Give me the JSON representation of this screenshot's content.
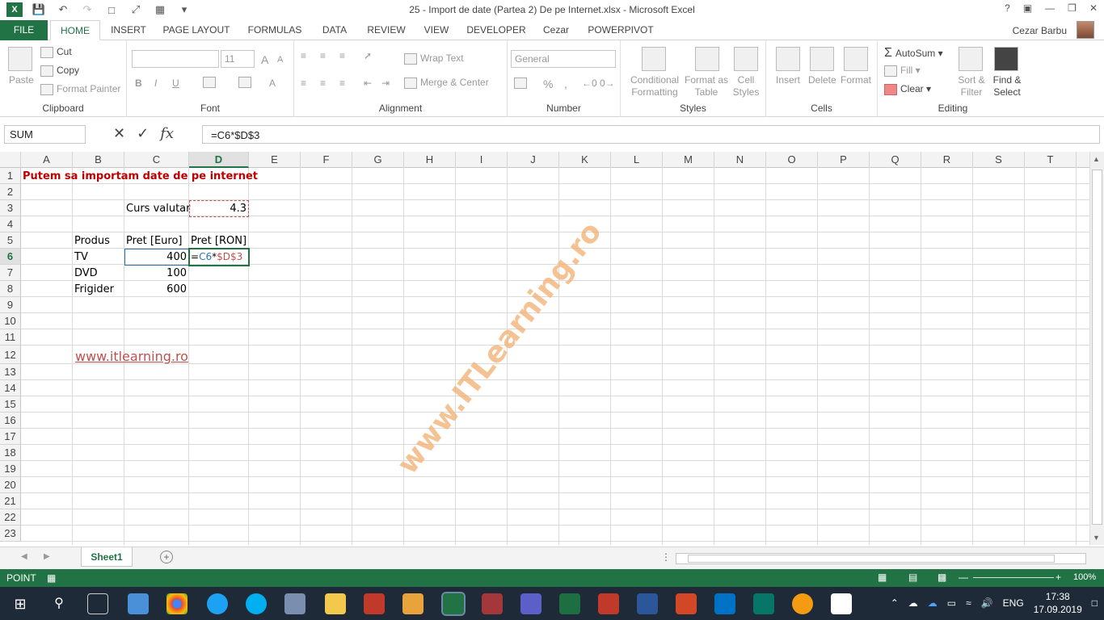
{
  "window": {
    "title": "25 - Import de date (Partea 2) De pe Internet.xlsx - Microsoft Excel",
    "help": "?",
    "user": "Cezar Barbu"
  },
  "tabs": [
    "FILE",
    "HOME",
    "INSERT",
    "PAGE LAYOUT",
    "FORMULAS",
    "DATA",
    "REVIEW",
    "VIEW",
    "DEVELOPER",
    "Cezar",
    "POWERPIVOT"
  ],
  "active_tab": "HOME",
  "ribbon": {
    "clipboard": {
      "label": "Clipboard",
      "paste": "Paste",
      "cut": "Cut",
      "copy": "Copy",
      "format_painter": "Format Painter"
    },
    "font": {
      "label": "Font",
      "size": "11",
      "bold": "B",
      "italic": "I",
      "underline": "U",
      "grow": "A",
      "shrink": "A",
      "color": "A"
    },
    "alignment": {
      "label": "Alignment",
      "wrap": "Wrap Text",
      "merge": "Merge & Center"
    },
    "number": {
      "label": "Number",
      "format": "General",
      "percent": "%",
      "comma": ","
    },
    "styles": {
      "label": "Styles",
      "conditional": "Conditional Formatting",
      "format_table": "Format as Table",
      "cell_styles": "Cell Styles"
    },
    "cells": {
      "label": "Cells",
      "insert": "Insert",
      "delete": "Delete",
      "format": "Format"
    },
    "editing": {
      "label": "Editing",
      "autosum": "AutoSum",
      "fill": "Fill",
      "clear": "Clear",
      "sort": "Sort & Filter",
      "find": "Find & Select"
    }
  },
  "formula_bar": {
    "name_box": "SUM",
    "fx": "fx",
    "formula": "=C6*$D$3"
  },
  "columns": [
    "A",
    "B",
    "C",
    "D",
    "E",
    "F",
    "G",
    "H",
    "I",
    "J",
    "K",
    "L",
    "M",
    "N",
    "O",
    "P",
    "Q",
    "R",
    "S",
    "T"
  ],
  "rows": [
    "1",
    "2",
    "3",
    "4",
    "5",
    "6",
    "7",
    "8",
    "9",
    "10",
    "11",
    "12",
    "13",
    "14",
    "15",
    "16",
    "17",
    "18",
    "19",
    "20",
    "21",
    "22",
    "23"
  ],
  "selected_col": "D",
  "selected_row": "6",
  "cells": {
    "A1": "Putem sa importam date de pe internet",
    "C3": "Curs valutar",
    "D3": "4.3",
    "B5": "Produs",
    "C5": "Pret [Euro]",
    "D5": "Pret [RON]",
    "B6": "TV",
    "C6": "400",
    "D6_eq": "=",
    "D6_ref1": "C6",
    "D6_op": "*",
    "D6_ref2": "$D$3",
    "B7": "DVD",
    "C7": "100",
    "B8": "Frigider",
    "C8": "600",
    "B12": "www.itlearning.ro"
  },
  "watermark": "www.ITLearning.ro",
  "sheet_tab": "Sheet1",
  "status": {
    "mode": "POINT",
    "zoom": "100%"
  },
  "taskbar": {
    "lang": "ENG",
    "time": "17:38",
    "date": "17.09.2019"
  },
  "colors": {
    "excel_green": "#217346",
    "title_red": "#c00000",
    "ref1": "#2f75b5",
    "ref2": "#c0504d",
    "link": "#c0504d"
  }
}
